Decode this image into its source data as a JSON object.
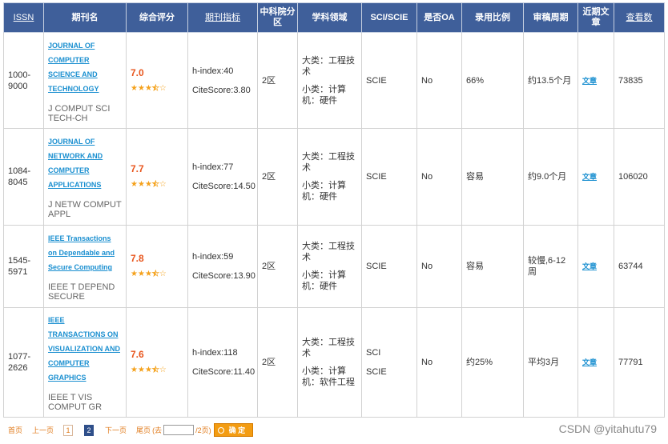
{
  "headers": {
    "issn": "ISSN",
    "name": "期刊名",
    "score": "综合评分",
    "metrics": "期刊指标",
    "cas": "中科院分区",
    "field": "学科领域",
    "sci": "SCI/SCIE",
    "oa": "是否OA",
    "rate": "录用比例",
    "cycle": "审稿周期",
    "recent": "近期文章",
    "views": "查看数"
  },
  "rows": [
    {
      "issn": "1000-9000",
      "name_lines": [
        "JOURNAL OF",
        "COMPUTER",
        "SCIENCE AND",
        "TECHNOLOGY"
      ],
      "abbr": "J COMPUT SCI TECH-CH",
      "score": "7.0",
      "rating": 3.5,
      "hindex": "h-index:40",
      "citescore": "CiteScore:3.80",
      "zone": "2区",
      "major": "大类：工程技术",
      "minor": "小类：计算机：硬件",
      "sci": [
        "SCIE"
      ],
      "oa": "No",
      "rate": "66%",
      "cycle": "约13.5个月",
      "article": "文章",
      "views": "73835"
    },
    {
      "issn": "1084-8045",
      "name_lines": [
        "JOURNAL OF",
        "NETWORK AND",
        "COMPUTER",
        "APPLICATIONS"
      ],
      "abbr": "J NETW COMPUT APPL",
      "score": "7.7",
      "rating": 3.5,
      "hindex": "h-index:77",
      "citescore": "CiteScore:14.50",
      "zone": "2区",
      "major": "大类：工程技术",
      "minor": "小类：计算机：硬件",
      "sci": [
        "SCIE"
      ],
      "oa": "No",
      "rate": "容易",
      "cycle": "约9.0个月",
      "article": "文章",
      "views": "106020"
    },
    {
      "issn": "1545-5971",
      "name_lines": [
        "IEEE Transactions",
        "on Dependable and",
        "Secure Computing"
      ],
      "abbr": "IEEE T DEPEND SECURE",
      "score": "7.8",
      "rating": 3.5,
      "hindex": "h-index:59",
      "citescore": "CiteScore:13.90",
      "zone": "2区",
      "major": "大类：工程技术",
      "minor": "小类：计算机：硬件",
      "sci": [
        "SCIE"
      ],
      "oa": "No",
      "rate": "容易",
      "cycle": "较慢,6-12周",
      "article": "文章",
      "views": "63744"
    },
    {
      "issn": "1077-2626",
      "name_lines": [
        "IEEE",
        "TRANSACTIONS ON",
        "VISUALIZATION AND",
        "COMPUTER",
        "GRAPHICS"
      ],
      "abbr": "IEEE T VIS COMPUT GR",
      "score": "7.6",
      "rating": 3.5,
      "hindex": "h-index:118",
      "citescore": "CiteScore:11.40",
      "zone": "2区",
      "major": "大类：工程技术",
      "minor": "小类：计算机：软件工程",
      "sci": [
        "SCI",
        "SCIE"
      ],
      "oa": "No",
      "rate": "约25%",
      "cycle": "平均3月",
      "article": "文章",
      "views": "77791"
    }
  ],
  "pager": {
    "first": "首页",
    "prev": "上一页",
    "page1": "1",
    "page2": "2",
    "next": "下一页",
    "last": "尾页",
    "goto_prefix": "(去",
    "goto_suffix": "/2页)",
    "ok": "确 定"
  },
  "watermark": "CSDN @yitahutu79"
}
